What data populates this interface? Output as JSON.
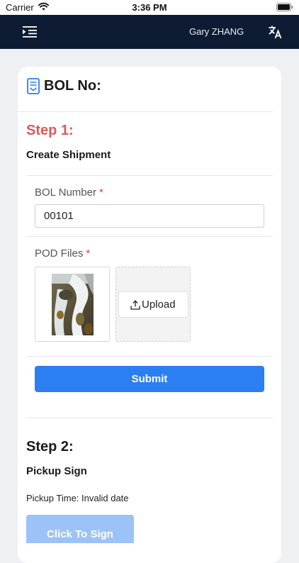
{
  "status_bar": {
    "carrier": "Carrier",
    "time": "3:36 PM"
  },
  "nav": {
    "user_name": "Gary ZHANG",
    "menu_icon": "indent-menu-icon",
    "translate_icon": "translate-icon",
    "background": "#0d1b33"
  },
  "card": {
    "title": "BOL No:",
    "title_icon": "document-icon"
  },
  "step1": {
    "title": "Step 1:",
    "subtitle": "Create Shipment",
    "title_color": "#e05858"
  },
  "form": {
    "bol_label": "BOL Number",
    "bol_value": "00101",
    "pod_label": "POD Files",
    "required_mark": "*",
    "upload_label": "Upload",
    "submit_label": "Submit",
    "accent": "#2b7ff0"
  },
  "step2": {
    "title": "Step 2:",
    "subtitle": "Pickup Sign",
    "pickup_time": "Pickup Time: Invalid date",
    "sign_label": "Click To Sign"
  }
}
